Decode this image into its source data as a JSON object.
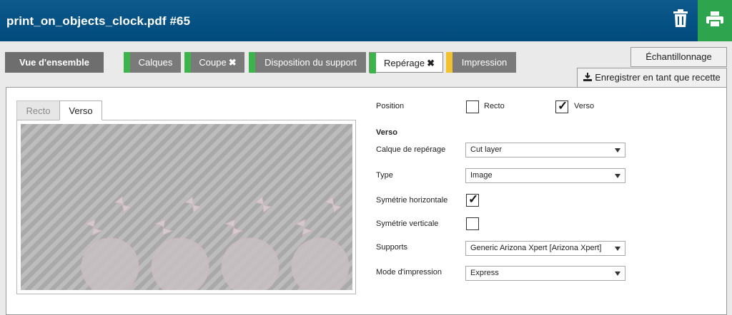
{
  "header": {
    "title": "print_on_objects_clock.pdf #65",
    "icons": [
      "trash-icon",
      "print-icon"
    ]
  },
  "tabs": [
    {
      "label": "Vue d'ensemble",
      "status": ""
    },
    {
      "label": "Calques",
      "status": "green"
    },
    {
      "label": "Coupe",
      "status": "green",
      "close": "✖"
    },
    {
      "label": "Disposition du support",
      "status": "green"
    },
    {
      "label": "Repérage",
      "status": "green",
      "close": "✖"
    },
    {
      "label": "Impression",
      "status": "yellow"
    }
  ],
  "colors": {
    "header": "#004a7c",
    "green": "#3cb44b",
    "yellow": "#f2c12e",
    "tab_gray": "#7a7a7a"
  },
  "actions": {
    "sample": "Échantillonnage",
    "save_recipe": "Enregistrer en tant que recette"
  },
  "view_tabs": {
    "recto": "Recto",
    "verso": "Verso"
  },
  "form": {
    "position_label": "Position",
    "recto_label": "Recto",
    "recto_checked": false,
    "verso_label": "Verso",
    "verso_checked": true,
    "section_title": "Verso",
    "calque_label": "Calque de repérage",
    "calque_value": "Cut layer",
    "type_label": "Type",
    "type_value": "Image",
    "sym_h_label": "Symétrie horizontale",
    "sym_h_checked": true,
    "sym_v_label": "Symétrie verticale",
    "sym_v_checked": false,
    "supports_label": "Supports",
    "supports_value": "Generic Arizona Xpert [Arizona Xpert]",
    "mode_label": "Mode d'impression",
    "mode_value": "Express"
  }
}
